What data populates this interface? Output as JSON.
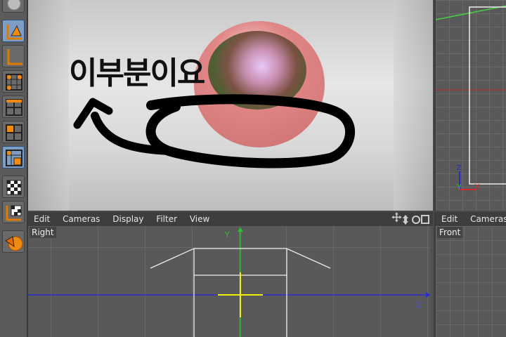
{
  "render": {
    "scribble_text": "이부분이요"
  },
  "bottom_viewport": {
    "menu": [
      "Edit",
      "Cameras",
      "Display",
      "Filter",
      "View"
    ],
    "label": "Right",
    "axis_y": "Y",
    "axis_z": "Z"
  },
  "right_bottom_viewport": {
    "menu": [
      "Edit",
      "Cameras"
    ],
    "label": "Front"
  },
  "right_top_viewport": {
    "axis_z": "Z",
    "axis_y": "Y",
    "axis_x": "X"
  },
  "toolbar": {
    "tools": [
      "globe-icon",
      "move-axis-icon",
      "axis-icon",
      "object-grid-icon",
      "points-grid-icon",
      "edges-grid-icon",
      "polygons-grid-icon",
      "uv-grid-icon",
      "texture-icon",
      "texture-axis-icon",
      "sculpt-icon"
    ]
  },
  "colors": {
    "active_tool": "#7d9dc4",
    "axis_green": "#29c42e",
    "axis_blue": "#2b2bcf",
    "axis_red": "#d02a2a",
    "yellow_cursor": "#f0f000"
  }
}
